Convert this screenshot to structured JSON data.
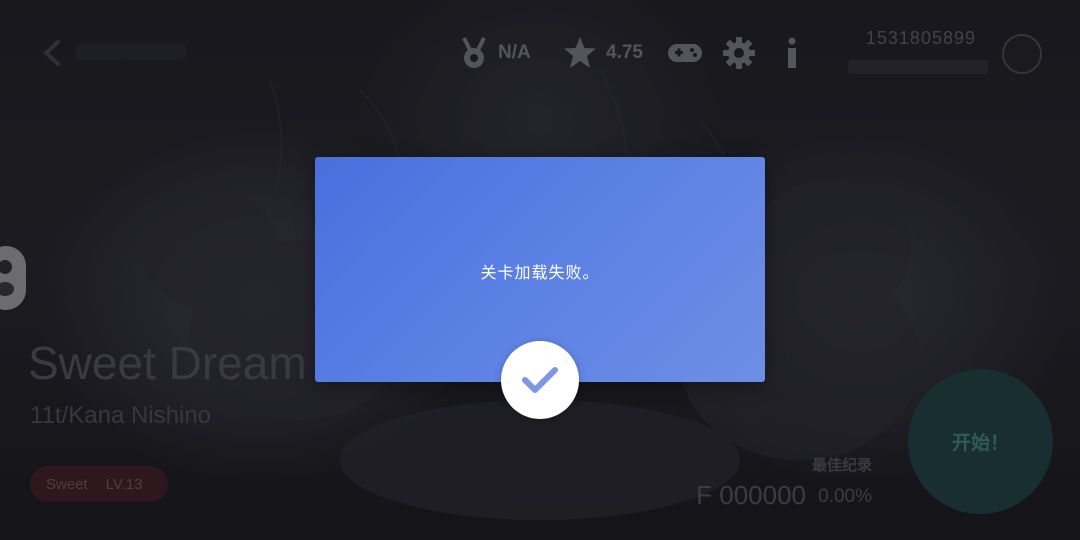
{
  "topbar": {
    "medal_text": "N/A",
    "rating_text": "4.75",
    "account_id": "1531805899"
  },
  "song": {
    "title": "Sweet Dream",
    "artist": "11t/Kana Nishino",
    "difficulty_name": "Sweet",
    "difficulty_level": "LV.13"
  },
  "record": {
    "label": "最佳纪录",
    "score": "F 000000",
    "accuracy": "0.00%"
  },
  "start_button": {
    "label": "开始！"
  },
  "dialog": {
    "message": "关卡加载失败。"
  },
  "colors": {
    "dialog_start": "#4a6fde",
    "dialog_end": "#6d8ee4",
    "confirm_check": "#7e97e4"
  }
}
